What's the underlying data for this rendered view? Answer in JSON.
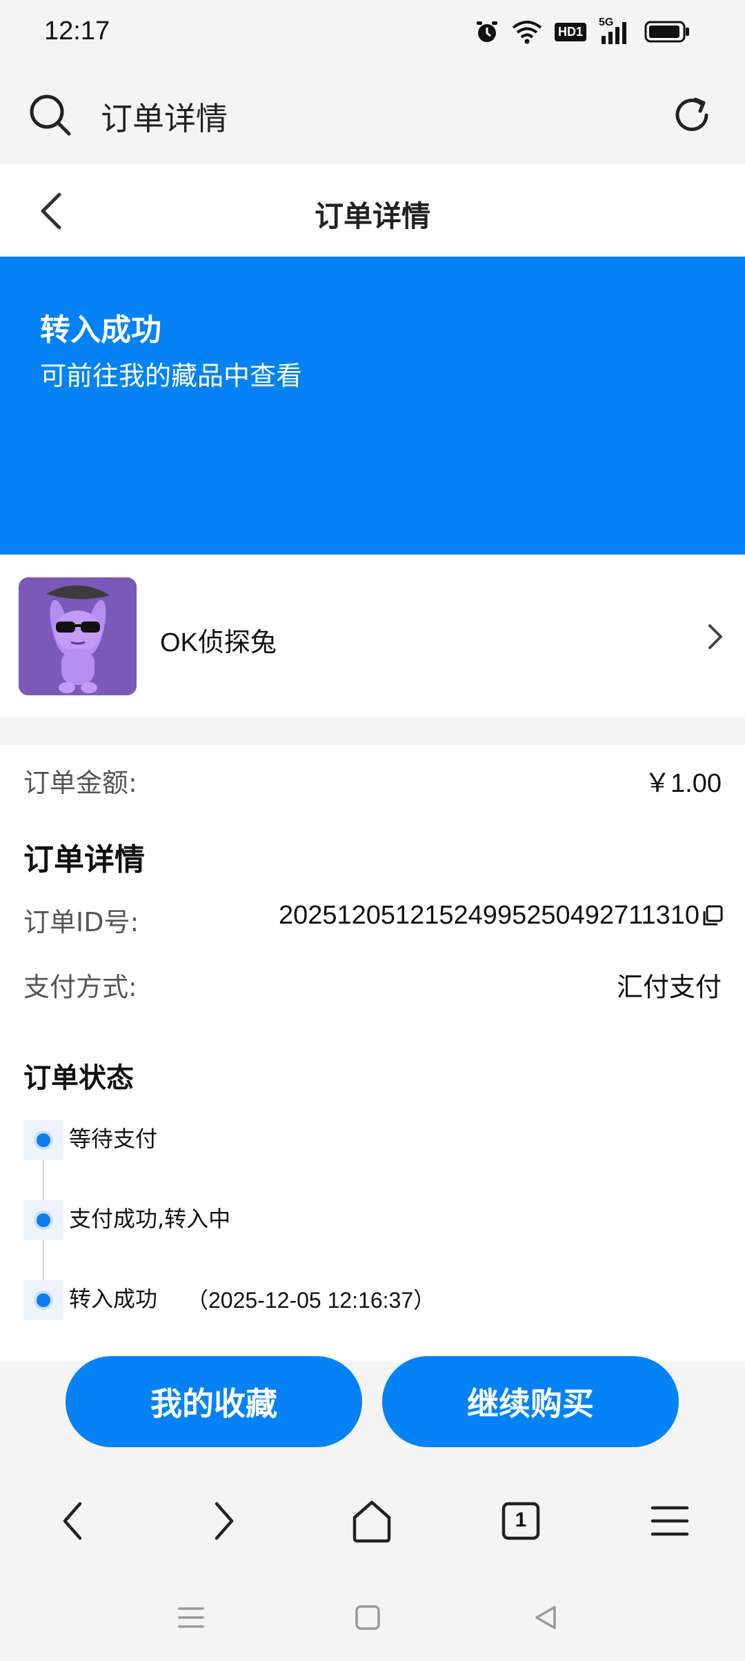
{
  "status_bar": {
    "time": "12:17",
    "network": "5G",
    "hd_label": "HD1"
  },
  "address_bar": {
    "text": "订单详情"
  },
  "nav": {
    "title": "订单详情"
  },
  "banner": {
    "title": "转入成功",
    "subtitle": "可前往我的藏品中查看",
    "color": "#0582f5"
  },
  "product": {
    "name": "OK侦探兔"
  },
  "order": {
    "amount_label": "订单金额:",
    "amount_value": "￥1.00",
    "details_title": "订单详情",
    "id_label": "订单ID号:",
    "id_value": "20251205121524995250492711310",
    "payment_label": "支付方式:",
    "payment_value": "汇付支付",
    "status_title": "订单状态",
    "steps": [
      {
        "label": "等待支付",
        "time": ""
      },
      {
        "label": "支付成功,转入中",
        "time": ""
      },
      {
        "label": "转入成功",
        "time": "（2025-12-05 12:16:37）"
      }
    ]
  },
  "actions": {
    "collection_label": "我的收藏",
    "continue_label": "继续购买"
  },
  "browser": {
    "tab_count": "1"
  }
}
